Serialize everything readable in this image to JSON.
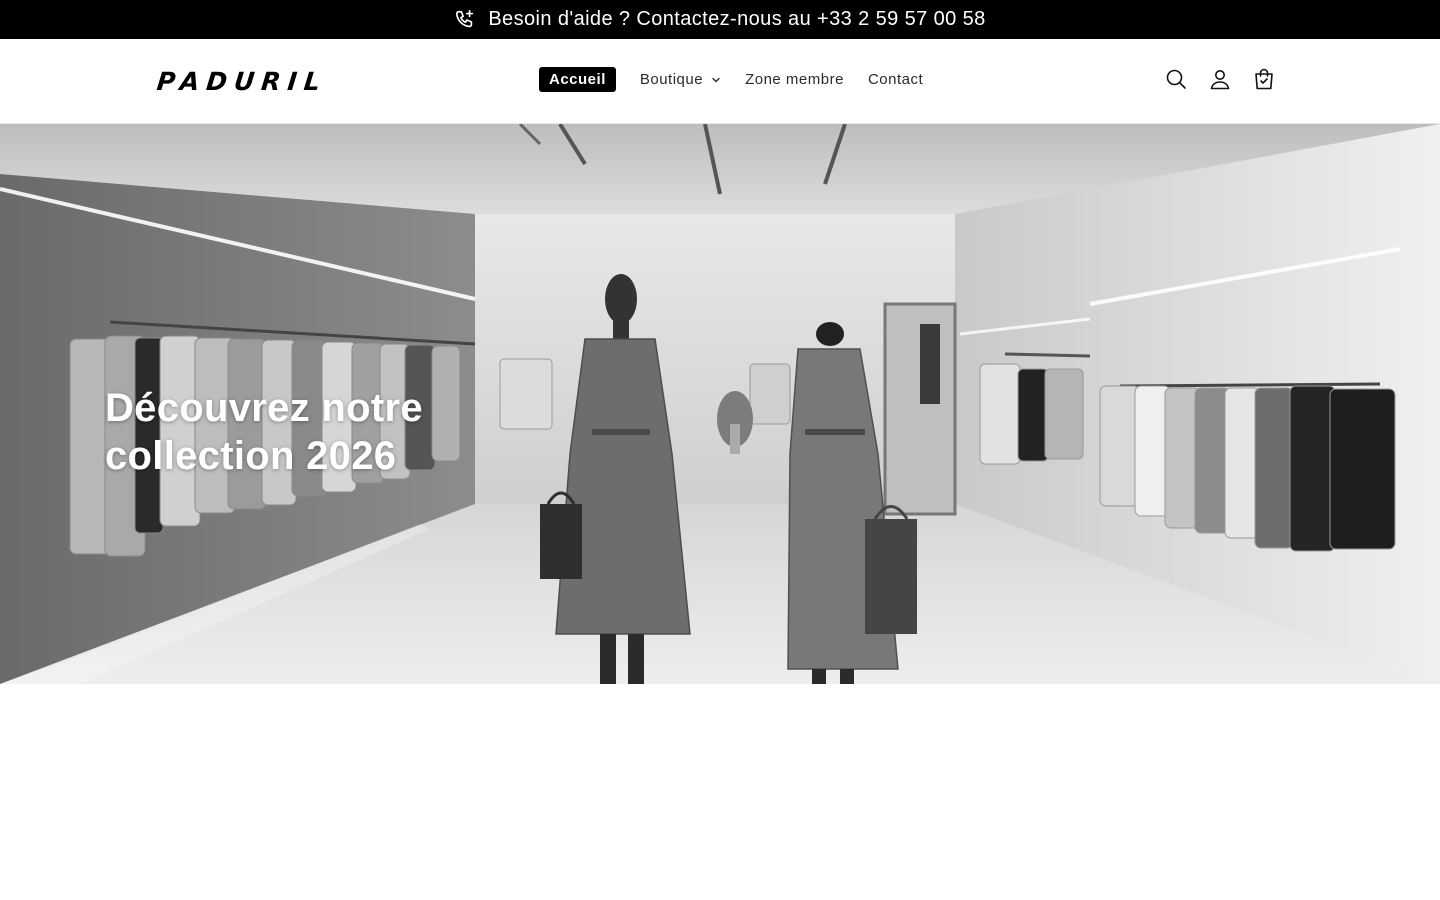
{
  "announcement": {
    "text": "Besoin d'aide ? Contactez-nous au +33 2 59 57 00 58",
    "icon": "phone-plus-icon"
  },
  "header": {
    "logo": "PADURIL",
    "nav": {
      "home": "Accueil",
      "shop": "Boutique",
      "members": "Zone membre",
      "contact": "Contact"
    },
    "icons": [
      "search-icon",
      "account-icon",
      "cart-icon"
    ]
  },
  "hero": {
    "title": "Découvrez notre collection 2026"
  },
  "colors": {
    "announcement_bg": "#000000",
    "active_nav_bg": "#000000",
    "text": "#121212"
  }
}
